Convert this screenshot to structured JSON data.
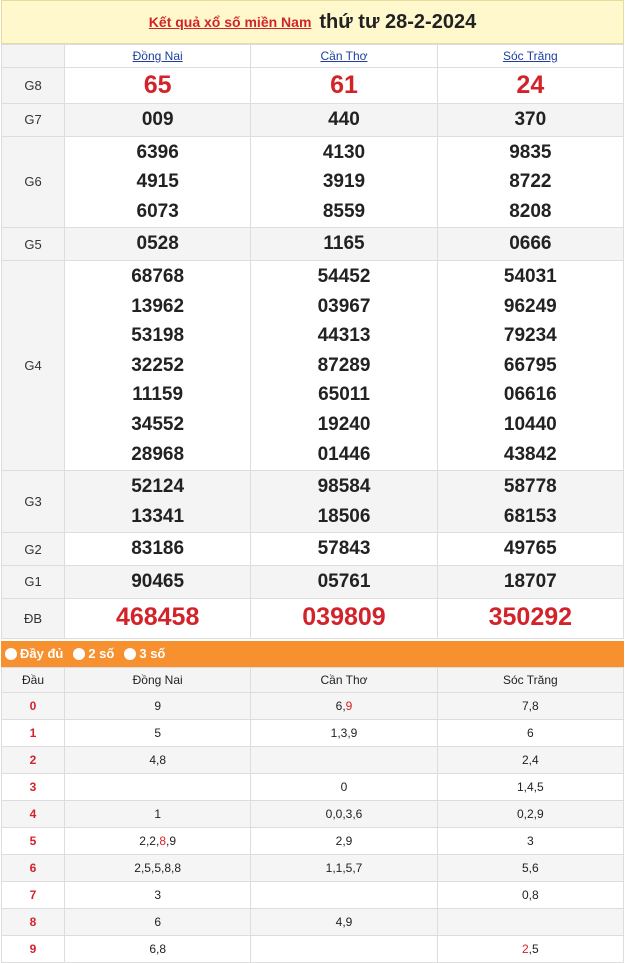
{
  "title": {
    "link": "Kết quả xổ số miền Nam",
    "date": "thứ tư 28-2-2024"
  },
  "provinces": [
    "Đồng Nai",
    "Cần Thơ",
    "Sóc Trăng"
  ],
  "prizes": {
    "g8": {
      "label": "G8",
      "values": [
        "65",
        "61",
        "24"
      ]
    },
    "g7": {
      "label": "G7",
      "values": [
        "009",
        "440",
        "370"
      ]
    },
    "g6": {
      "label": "G6",
      "values": [
        [
          "6396",
          "4915",
          "6073"
        ],
        [
          "4130",
          "3919",
          "8559"
        ],
        [
          "9835",
          "8722",
          "8208"
        ]
      ]
    },
    "g5": {
      "label": "G5",
      "values": [
        "0528",
        "1165",
        "0666"
      ]
    },
    "g4": {
      "label": "G4",
      "values": [
        [
          "68768",
          "13962",
          "53198",
          "32252",
          "11159",
          "34552",
          "28968"
        ],
        [
          "54452",
          "03967",
          "44313",
          "87289",
          "65011",
          "19240",
          "01446"
        ],
        [
          "54031",
          "96249",
          "79234",
          "66795",
          "06616",
          "10440",
          "43842"
        ]
      ]
    },
    "g3": {
      "label": "G3",
      "values": [
        [
          "52124",
          "13341"
        ],
        [
          "98584",
          "18506"
        ],
        [
          "58778",
          "68153"
        ]
      ]
    },
    "g2": {
      "label": "G2",
      "values": [
        "83186",
        "57843",
        "49765"
      ]
    },
    "g1": {
      "label": "G1",
      "values": [
        "90465",
        "05761",
        "18707"
      ]
    },
    "db": {
      "label": "ĐB",
      "values": [
        "468458",
        "039809",
        "350292"
      ]
    }
  },
  "tabs": [
    "Đầy đủ",
    "2 số",
    "3 số"
  ],
  "dau_table": {
    "header": "Đầu",
    "rows": [
      {
        "k": "0",
        "c": [
          [
            "9"
          ],
          [
            "6,",
            {
              "h": "9"
            }
          ],
          [
            "7,8"
          ]
        ]
      },
      {
        "k": "1",
        "c": [
          [
            "5"
          ],
          [
            "1,3,9"
          ],
          [
            "6"
          ]
        ]
      },
      {
        "k": "2",
        "c": [
          [
            "4,8"
          ],
          [
            ""
          ],
          [
            "2,4"
          ]
        ]
      },
      {
        "k": "3",
        "c": [
          [
            ""
          ],
          [
            "0"
          ],
          [
            "1,4,5"
          ]
        ]
      },
      {
        "k": "4",
        "c": [
          [
            "1"
          ],
          [
            "0,0,3,6"
          ],
          [
            "0,2,9"
          ]
        ]
      },
      {
        "k": "5",
        "c": [
          [
            "2,2,",
            {
              "h": "8"
            },
            ",9"
          ],
          [
            "2,9"
          ],
          [
            "3"
          ]
        ]
      },
      {
        "k": "6",
        "c": [
          [
            "2,5,5,8,8"
          ],
          [
            "1,1,5,7"
          ],
          [
            "5,6"
          ]
        ]
      },
      {
        "k": "7",
        "c": [
          [
            "3"
          ],
          [
            ""
          ],
          [
            "0,8"
          ]
        ]
      },
      {
        "k": "8",
        "c": [
          [
            "6"
          ],
          [
            "4,9"
          ],
          [
            ""
          ]
        ]
      },
      {
        "k": "9",
        "c": [
          [
            "6,8"
          ],
          [
            ""
          ],
          [
            {
              "h": "2"
            },
            ",5"
          ]
        ]
      }
    ]
  },
  "colors": {
    "red": "#d3232a",
    "orange": "#f7902f",
    "title_bg": "#fff8cc",
    "link_blue": "#1d3f9e"
  }
}
